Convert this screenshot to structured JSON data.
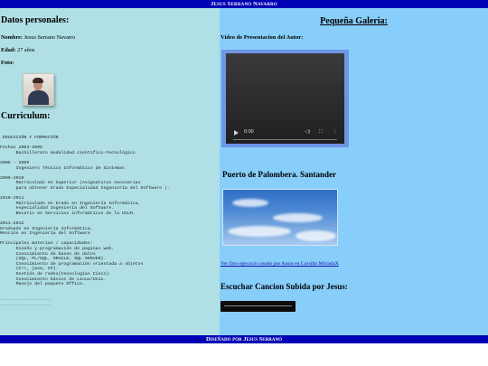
{
  "header": {
    "title": "Jesus Serrano Navarro"
  },
  "footer": {
    "text": "Diseñado por Jesus Serrano"
  },
  "personal": {
    "heading": "Datos personales:",
    "name_label": "Nombre:",
    "name_value": "Jesus Serrano Navarro",
    "age_label": "Edad:",
    "age_value": "27 años",
    "photo_label": "Foto:"
  },
  "curriculum": {
    "heading": "Curriculum:",
    "text": " EDUCACIÓN Y FORMACIÓN\n\nFechas 2003-2005\n      Bachillerato modalidad cientifico-tecnológico\n\n2005 - 2009\n      Ingeniero Técnico Informático de Sistemas\n\n2009-2010\n      Matriculado en Superior (Asignaturas necesarias\n      para obtener Grado Especialidad Ingeniería del Software ).\n\n2010-2011\n      Matriculado en Grado en Ingeniería Informática,\n      especialidad Ingeniería del Software.\n      Becario en Servicios informáticos de la UCLM.\n\n2011-2012\nGraduado en Ingeniería Informática.\nMención en Ingeniería del Software\n\nPrincipales materias / capacidades:\n      Diseño y programación de paginas web.\n      Conocimiento de bases de datos\n      (SQL, PL/SQL, ORACLE, SQL SERVER).\n      Conocimiento de programación orientada a objetos\n      (C++, java, C#).\n      Gestión de redes(tecnologías Cisco).\n      Conocimiento básico de Linux/Unix.\n      Manejo del paquete Office.\n\n\n...................\n..................."
  },
  "gallery": {
    "heading": "Pequeña Galeria:",
    "video_label": "Video de Presentacion del Autor:",
    "video_time": "0:00",
    "image_caption": "Puerto de Palombera. Santander",
    "link_text": "Ver Otro ejercicio creado por Autor en Cursillo MiriadaX",
    "audio_heading": "Escuchar Cancion Subida por Jesus:"
  },
  "icons": {
    "play": "play-icon",
    "volume": "volume-icon",
    "fullscreen": "fullscreen-icon",
    "more": "more-options-icon"
  },
  "colors": {
    "header_bg": "#0000b4",
    "left_bg": "#b0e0e6",
    "right_bg": "#87cefa",
    "video_frame": "#6f95e6",
    "link": "#1a0dab"
  }
}
